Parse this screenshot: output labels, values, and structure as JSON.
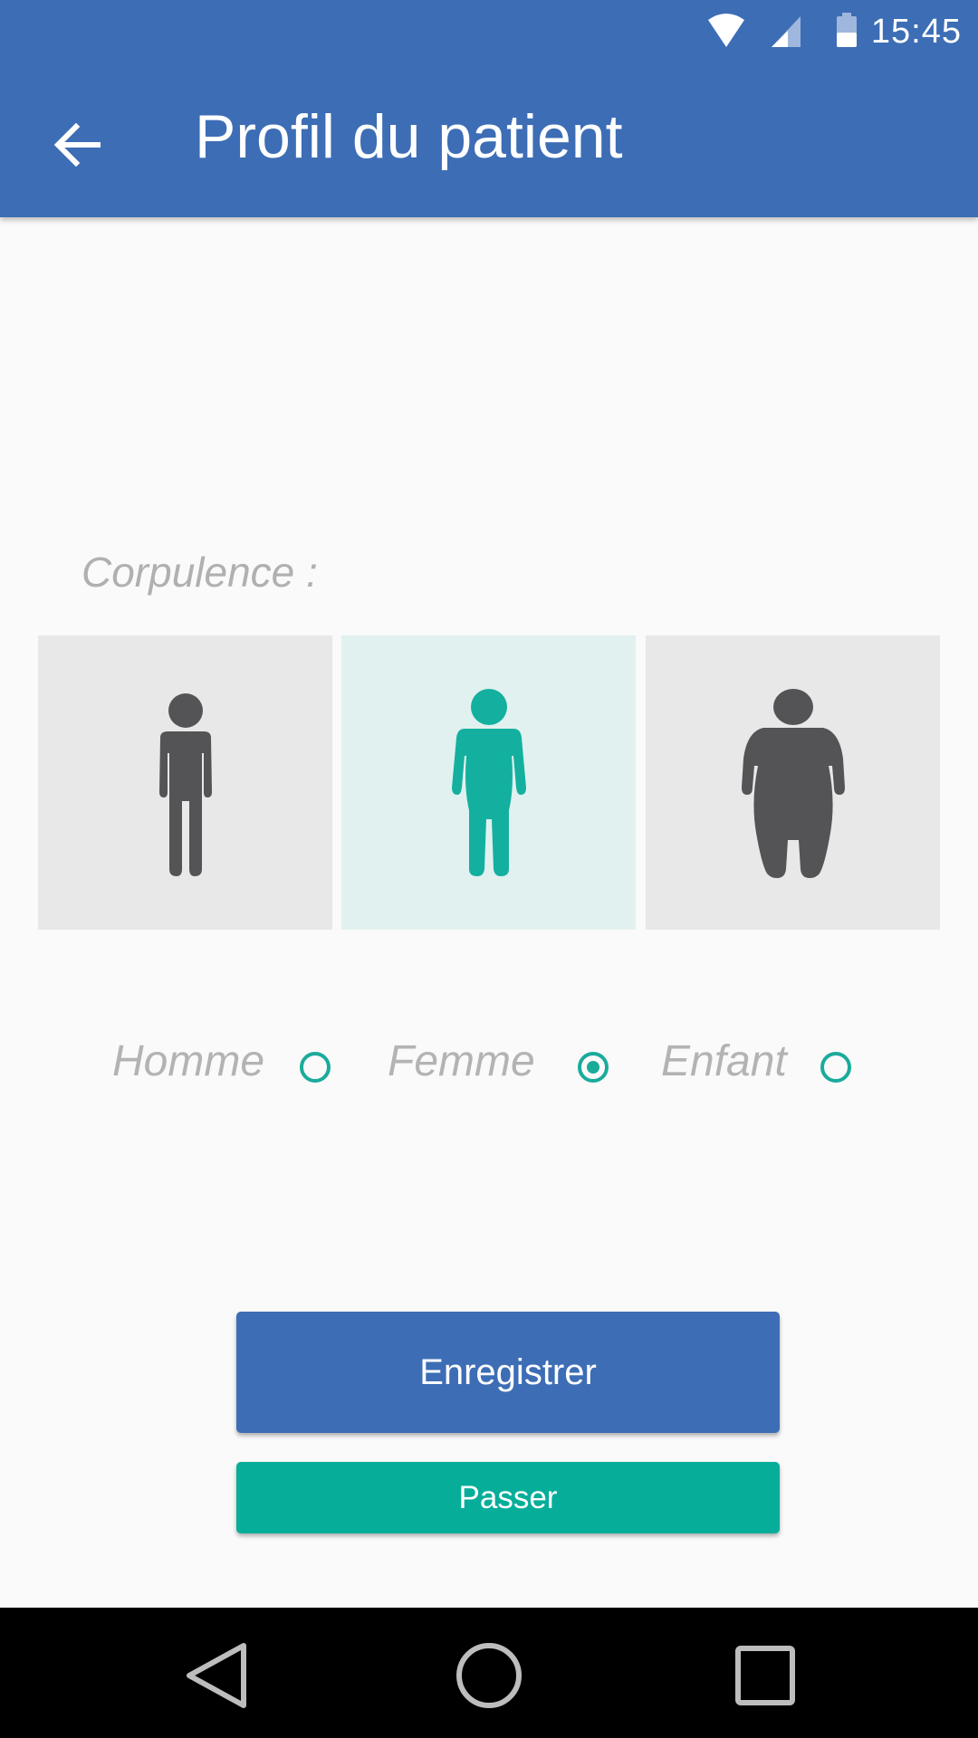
{
  "status_bar": {
    "time": "15:45",
    "icons": [
      "wifi-icon",
      "signal-icon",
      "battery-icon"
    ]
  },
  "app_bar": {
    "title": "Profil du patient",
    "back_icon": "arrow-left-icon",
    "color": "#3d6db5"
  },
  "corpulence": {
    "label": "Corpulence :",
    "options": [
      {
        "label": "Homme",
        "selected": false,
        "icon": "slim-figure-icon"
      },
      {
        "label": "Femme",
        "selected": true,
        "icon": "medium-figure-icon"
      },
      {
        "label": "Enfant",
        "selected": false,
        "icon": "large-figure-icon"
      }
    ]
  },
  "actions": {
    "save_label": "Enregistrer",
    "skip_label": "Passer"
  },
  "nav_bar": {
    "icons": [
      "back-triangle-icon",
      "home-circle-icon",
      "recents-square-icon"
    ]
  },
  "colors": {
    "primary": "#3d6db5",
    "accent": "#06ae9a",
    "selected_tile": "#e1f1f0",
    "tile": "#e8e8e8",
    "figure": "#545456"
  }
}
